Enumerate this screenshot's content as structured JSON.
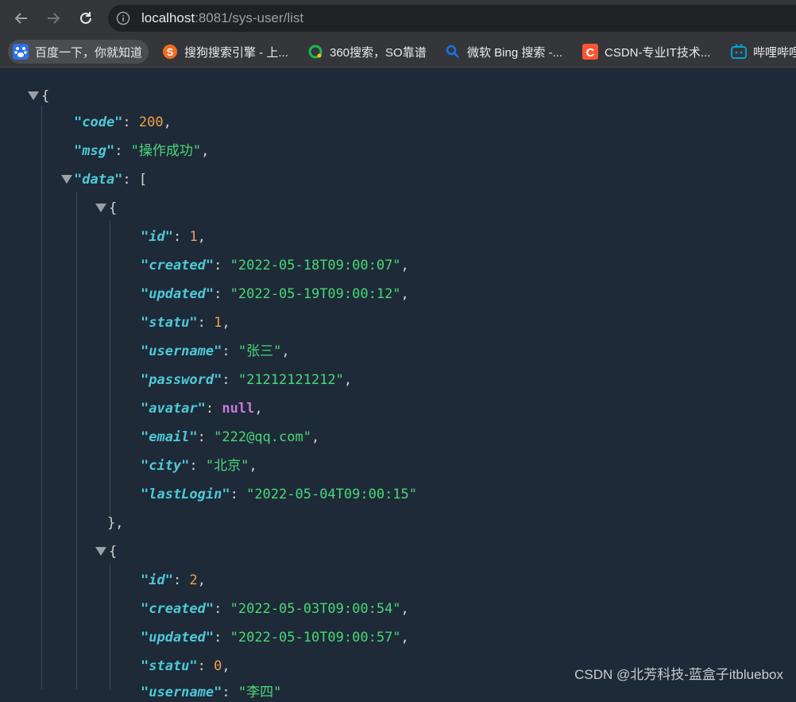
{
  "browser": {
    "url_host": "localhost",
    "url_rest": ":8081/sys-user/list",
    "bookmarks": [
      {
        "label": "百度一下，你就知道",
        "icon": "baidu-paw-icon",
        "color": "#2e6fe8"
      },
      {
        "label": "搜狗搜索引擎 - 上...",
        "icon": "sogou-icon",
        "color": "#f36c21"
      },
      {
        "label": "360搜索，SO靠谱",
        "icon": "360-search-icon",
        "color": "#19b955"
      },
      {
        "label": "微软 Bing 搜索 -...",
        "icon": "bing-search-icon",
        "color": "#1a73e8"
      },
      {
        "label": "CSDN-专业IT技术...",
        "icon": "csdn-icon",
        "color": "#fc5531"
      },
      {
        "label": "哔哩哔哩",
        "icon": "bilibili-icon",
        "color": "#00a1d6"
      }
    ]
  },
  "json": {
    "open_brace": "{",
    "code_key": "\"code\"",
    "code_value": "200",
    "msg_key": "\"msg\"",
    "msg_value": "\"操作成功\"",
    "data_key": "\"data\"",
    "data_open": "[",
    "records": [
      {
        "id": "1",
        "created": "\"2022-05-18T09:00:07\"",
        "updated": "\"2022-05-19T09:00:12\"",
        "statu": "1",
        "username": "\"张三\"",
        "password": "\"21212121212\"",
        "avatar": "null",
        "email": "\"222@qq.com\"",
        "city": "\"北京\"",
        "lastLogin": "\"2022-05-04T09:00:15\""
      },
      {
        "id": "2",
        "created": "\"2022-05-03T09:00:54\"",
        "updated": "\"2022-05-10T09:00:57\"",
        "statu": "0",
        "username_partial_key": "\"username\"",
        "username_partial_value": "\"李四\""
      }
    ]
  },
  "watermark": "CSDN @北芳科技-蓝盒子itbluebox",
  "colors": {
    "background": "#1e2a37",
    "key": "#4ec9d8",
    "number": "#f0a04b",
    "string": "#48d779",
    "null": "#c678dd"
  }
}
